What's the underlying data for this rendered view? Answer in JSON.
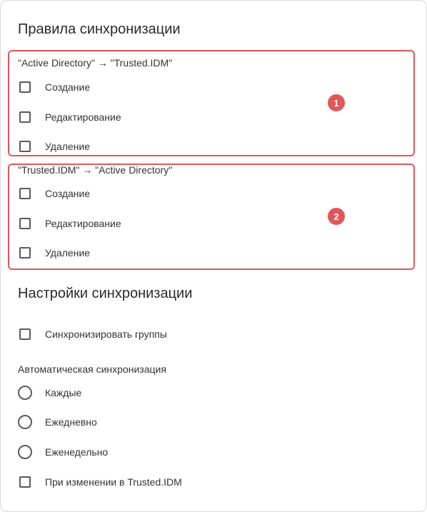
{
  "sync_rules": {
    "title": "Правила синхронизации",
    "groups": [
      {
        "label": "\"Active Directory\" → \"Trusted.IDM\"",
        "badge": "1",
        "options": [
          "Создание",
          "Редактирование",
          "Удаление"
        ],
        "checked": [
          false,
          false,
          false
        ]
      },
      {
        "label": "\"Trusted.IDM\" → \"Active Directory\"",
        "badge": "2",
        "options": [
          "Создание",
          "Редактирование",
          "Удаление"
        ],
        "checked": [
          false,
          false,
          false
        ]
      }
    ]
  },
  "sync_settings": {
    "title": "Настройки синхронизации",
    "sync_groups_label": "Синхронизировать группы",
    "sync_groups_checked": false,
    "auto_sync": {
      "label": "Автоматическая синхронизация",
      "options": [
        "Каждые",
        "Ежедневно",
        "Еженедельно"
      ],
      "selected": null
    },
    "on_change_label": "При изменении в Trusted.IDM",
    "on_change_checked": false
  },
  "colors": {
    "highlight": "#e0575b",
    "border": "#d9d9d9",
    "control": "#5a5a5a"
  }
}
